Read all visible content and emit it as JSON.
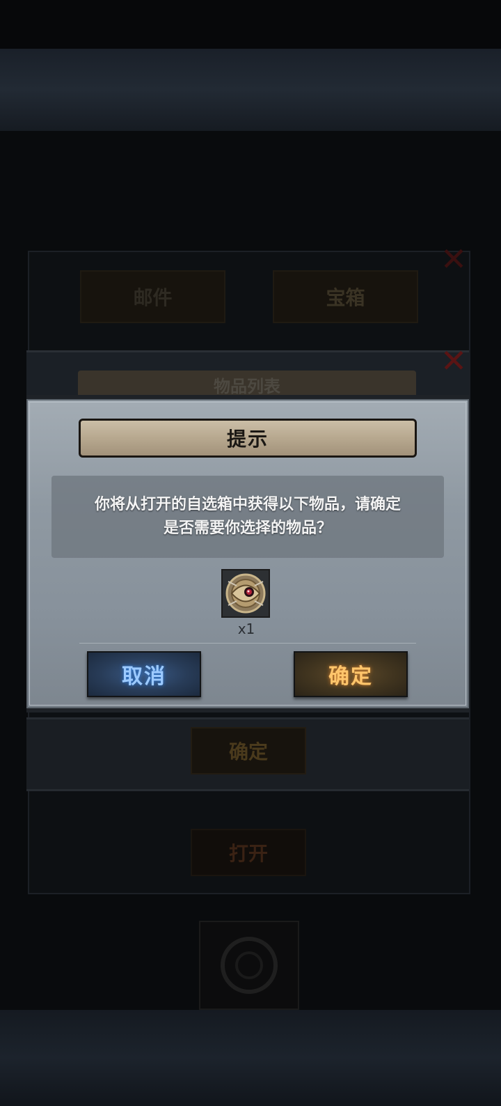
{
  "background": {
    "title": "",
    "tabs": [
      "邮件",
      "宝箱"
    ],
    "list_banner": "物品列表",
    "confirm_label": "确定",
    "open_label": "打开"
  },
  "dialog": {
    "title": "提示",
    "message_line1": "你将从打开的自选箱中获得以下物品，请确定",
    "message_line2": "是否需要你选择的物品？",
    "item": {
      "icon": "ornate-shield-icon",
      "count": "x1"
    },
    "cancel_label": "取消",
    "confirm_label": "确定"
  },
  "colors": {
    "cancel_text": "#9ccaff",
    "confirm_text": "#ffc56b",
    "close_x": "#b31414"
  }
}
